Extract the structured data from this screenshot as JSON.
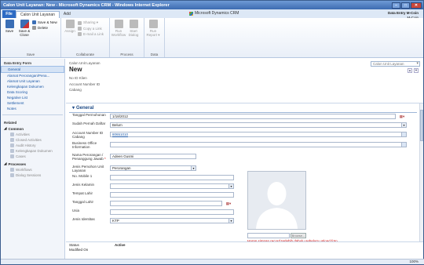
{
  "window": {
    "title": "Calon Unit Layanan: New - Microsoft Dynamics CRM - Windows Internet Explorer",
    "controls": [
      "–",
      "□",
      "✕"
    ]
  },
  "ribbon_tabs": {
    "file": "File",
    "entity": "Calon Unit Layanan",
    "add": "Add"
  },
  "brand": "Microsoft Dynamics CRM",
  "user": {
    "name": "Data Entry M-Coin",
    "org": "M-Coin"
  },
  "ribbon": {
    "save_group": {
      "label": "Save",
      "save": "Save",
      "save_close": "Save & Close",
      "save_new": "Save & New",
      "delete": "Delete"
    },
    "collab_group": {
      "label": "Collaborate",
      "assign": "Assign",
      "sharing": "Sharing ▾",
      "copy_link": "Copy a Link",
      "email_link": "E-mail a Link"
    },
    "process_group": {
      "label": "Process",
      "run_workflow": "Run Workflow",
      "start_dialog": "Start Dialog"
    },
    "data_group": {
      "label": "Data",
      "run_report": "Run Report ▾"
    }
  },
  "left_nav": {
    "form_header": "Data Entry Form",
    "items": [
      "General",
      "Alamat Perorangan/Pena...",
      "Alamat Unit Layanan",
      "Kelengkapan Dokumen",
      "Data Scoring",
      "Negative List",
      "Settlement",
      "Notes"
    ],
    "related_header": "Related",
    "common_header": "Common",
    "common_items": [
      "Activities",
      "Closed Activities",
      "Audit History",
      "Kelengkapan Dokumen",
      "Cases"
    ],
    "processes_header": "Processes",
    "process_items": [
      "Workflows",
      "Dialog Sessions"
    ]
  },
  "header": {
    "entity": "Calon Unit Layanan",
    "title": "New",
    "fields": [
      "No ID Klien",
      "Account Number ID",
      "Cabang"
    ],
    "form_selector": "Calon Unit Layanan"
  },
  "section": {
    "title": "General"
  },
  "form": {
    "tanggal_permohonan": {
      "label": "Tanggal Permohonan",
      "value": "1/18/2012"
    },
    "sudah_pernah_daftar": {
      "label": "Sudah Pernah Daftar",
      "value": "Belum"
    },
    "account_number_id": {
      "label": "Account Number ID Cabang",
      "value": "80651010"
    },
    "business_office": {
      "label": "Business Office Information",
      "value": ""
    },
    "nama_perorangan": {
      "label": "Nama Perorangan / Penanggung Jawab",
      "value": "Adeen Gusmi"
    },
    "jenis_pemohon": {
      "label": "Jenis Pemohon Unit Layanan",
      "value": "Perorangan"
    },
    "no_mobile": {
      "label": "No. Mobile 1",
      "value": ""
    },
    "jenis_kelamin": {
      "label": "Jenis Kelamin",
      "value": ""
    },
    "tempat_lahir": {
      "label": "Tempat Lahir",
      "value": ""
    },
    "tanggal_lahir": {
      "label": "Tanggal Lahir",
      "value": ""
    },
    "usia": {
      "label": "Usia",
      "value": ""
    },
    "jenis_identitas": {
      "label": "Jenis Identitas",
      "value": "KTP"
    }
  },
  "photo": {
    "browse": "Browse...",
    "warning": "Harap simpan record terlebih dahulu sebelum upload foto",
    "show_information": "Show Information"
  },
  "footer": {
    "status_label": "Status",
    "status_value": "Active",
    "modified_label": "Modified On"
  },
  "statusbar": {
    "zoom": "100%"
  },
  "colors": {
    "accent": "#1e5aa8",
    "title_bar": "#3c6bb0",
    "warning": "#cc0000"
  }
}
